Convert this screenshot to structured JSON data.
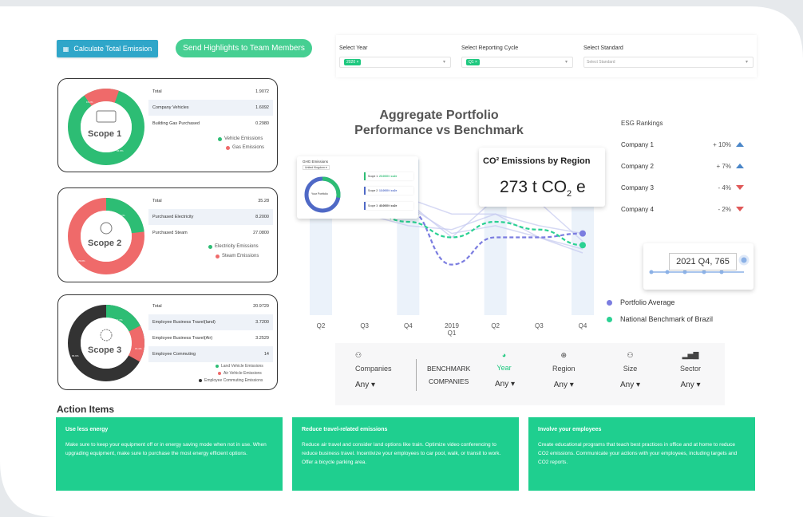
{
  "toolbar": {
    "calculate_label": "Calculate Total Emission",
    "send_label": "Send Highlights to Team Members"
  },
  "filters": {
    "year_label": "Select Year",
    "year_value": "2020",
    "cycle_label": "Select Reporting Cycle",
    "cycle_value": "Q1",
    "standard_label": "Select Standard",
    "standard_placeholder": "Select Standard"
  },
  "scope1": {
    "label": "Scope 1",
    "ring_green_pct": "84.8%",
    "ring_red_pct": "15.2%",
    "rows": [
      {
        "name": "Total",
        "value": "1.9072"
      },
      {
        "name": "Company Vehicles",
        "value": "1.6092"
      },
      {
        "name": "Building Gas Purchased",
        "value": "0.2980"
      }
    ],
    "legend": [
      "Vehicle Emissions",
      "Gas Emissions"
    ]
  },
  "scope2": {
    "label": "Scope 2",
    "ring_green_pct": "23.2%",
    "ring_red_pct": "76.8%",
    "rows": [
      {
        "name": "Total",
        "value": "35.28"
      },
      {
        "name": "Purchased Electricity",
        "value": "8.2000"
      },
      {
        "name": "Purchased Steam",
        "value": "27.0800"
      }
    ],
    "legend": [
      "Electricity Emissions",
      "Steam Emissions"
    ]
  },
  "scope3": {
    "label": "Scope 3",
    "ring_green_pct": "17.7%",
    "ring_red_pct": "15.4%",
    "ring_dark_pct": "66.9%",
    "rows": [
      {
        "name": "Total",
        "value": "20.9729"
      },
      {
        "name": "Employee Business Travel(land)",
        "value": "3.7200"
      },
      {
        "name": "Employee Business Travel(Air)",
        "value": "3.2529"
      },
      {
        "name": "Employee Commuting",
        "value": "14"
      }
    ],
    "legend": [
      "Land Vehicle Emissions",
      "Air Vehicle Emissions",
      "Employee Commuting Emissions"
    ]
  },
  "chart_section": {
    "title_line1": "Aggregate Portfolio",
    "title_line2": "Performance vs Benchmark",
    "co2_title": "CO² Emissions by Region",
    "co2_value": "273 t CO",
    "co2_sub": "2",
    "co2_unit": " e",
    "tooltip": "2021 Q4, 765",
    "legend_portfolio": "Portfolio Average",
    "legend_national": "National Benchmark of Brazil"
  },
  "ghg_popup": {
    "title": "GHG Emissions",
    "select": "United Kingdom",
    "center": "Your Portfolio",
    "items": [
      {
        "scope": "Scope 1:",
        "val": "20.0000 t co2e"
      },
      {
        "scope": "Scope 2:",
        "val": "13.0000 t co2e"
      },
      {
        "scope": "Scope 3:",
        "val": "40.0000 t co2e"
      }
    ]
  },
  "esg": {
    "title": "ESG Rankings",
    "rows": [
      {
        "company": "Company 1",
        "change": "+ 10%",
        "dir": "up"
      },
      {
        "company": "Company 2",
        "change": "+ 7%",
        "dir": "up"
      },
      {
        "company": "Company 3",
        "change": "- 4%",
        "dir": "down"
      },
      {
        "company": "Company 4",
        "change": "- 2%",
        "dir": "down"
      }
    ]
  },
  "benchmark": {
    "companies_label": "Companies",
    "companies_value": "Any",
    "bench_title_1": "BENCHMARK",
    "bench_title_2": "COMPANIES",
    "year_label": "Year",
    "year_value": "Any",
    "region_label": "Region",
    "region_value": "Any",
    "size_label": "Size",
    "size_value": "Any",
    "sector_label": "Sector",
    "sector_value": "Any"
  },
  "actions": {
    "title": "Action Items",
    "items": [
      {
        "heading": "Use less energy",
        "body": "Make sure to keep your equipment off or in energy saving mode when not in use. When upgrading equipment, make sure to purchase the most energy efficient options."
      },
      {
        "heading": "Reduce travel-related emissions",
        "body": "Reduce air travel and consider land options like train. Optimize video conferencing to reduce business travel. Incentivize your employees to car pool, walk, or transit to work. Offer a bicycle parking area."
      },
      {
        "heading": "Involve your employees",
        "body": "Create educational programs that teach best practices in office and at home to reduce CO2 emissions. Communicate your actions with your employees, including targets and CO2 reports."
      }
    ]
  },
  "chart_data": {
    "type": "line",
    "categories": [
      "Q2",
      "Q3",
      "Q4",
      "2019 Q1",
      "Q2",
      "Q3",
      "Q4"
    ],
    "series": [
      {
        "name": "Portfolio Average",
        "values": [
          350,
          345,
          335,
          265,
          300,
          300,
          305
        ]
      },
      {
        "name": "National Benchmark of Brazil",
        "values": [
          350,
          335,
          320,
          300,
          320,
          310,
          290
        ]
      }
    ],
    "colors": {
      "portfolio": "#7b7de0",
      "national": "#2bd193",
      "bands": "#dde9f7"
    }
  }
}
